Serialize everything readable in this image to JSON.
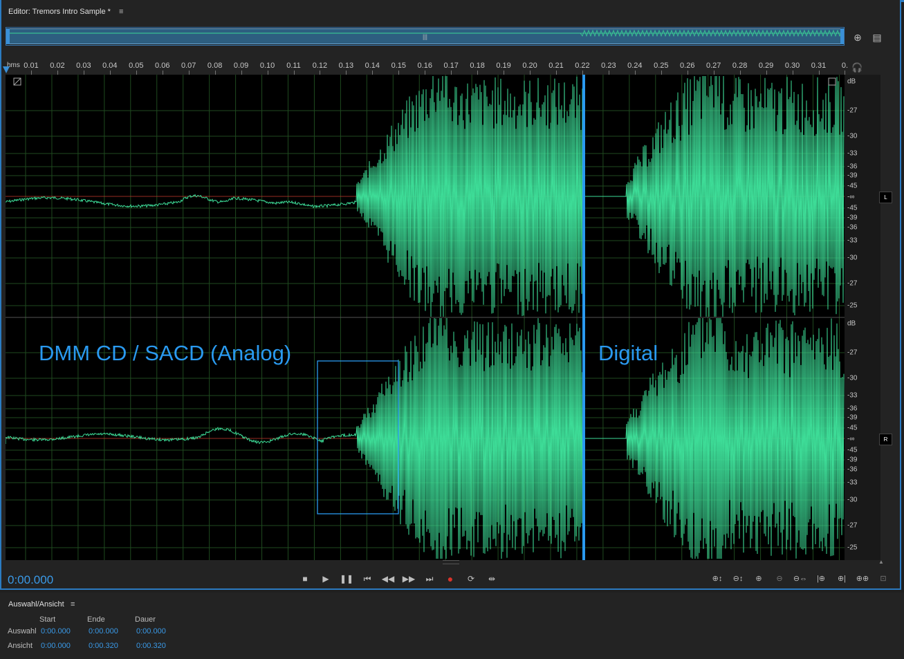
{
  "editor": {
    "title": "Editor: Tremors Intro Sample *",
    "menu_glyph": "≡"
  },
  "ruler": {
    "unit": "hms",
    "labels": [
      "0.01",
      "0.02",
      "0.03",
      "0.04",
      "0.05",
      "0.06",
      "0.07",
      "0.08",
      "0.09",
      "0.10",
      "0.11",
      "0.12",
      "0.13",
      "0.14",
      "0.15",
      "0.16",
      "0.17",
      "0.18",
      "0.19",
      "0.20",
      "0.21",
      "0.22",
      "0.23",
      "0.24",
      "0.25",
      "0.26",
      "0.27",
      "0.28",
      "0.29",
      "0.30",
      "0.31",
      "0."
    ]
  },
  "channels": {
    "L": {
      "label": "L",
      "db_scale": [
        "dB",
        "-27",
        "-30",
        "-33",
        "-36",
        "-39",
        "-45",
        "-∞",
        "-45",
        "-39",
        "-36",
        "-33",
        "-30",
        "-27",
        "-25"
      ]
    },
    "R": {
      "label": "R",
      "db_scale": [
        "dB",
        "-27",
        "-30",
        "-33",
        "-36",
        "-39",
        "-45",
        "-∞",
        "-45",
        "-39",
        "-36",
        "-33",
        "-30",
        "-27",
        "-25"
      ]
    }
  },
  "annotations": {
    "left": "DMM CD / SACD (Analog)",
    "right": "Digital"
  },
  "colors": {
    "waveform": "#3ddc97",
    "accent": "#2a9af0",
    "centerline": "#c0392b",
    "grid": "#1f4a1f"
  },
  "transport": {
    "current_time": "0:00.000",
    "buttons": [
      "stop",
      "play",
      "pause",
      "go-to-start",
      "rewind",
      "fast-forward",
      "go-to-end",
      "record",
      "loop",
      "skip-selection"
    ]
  },
  "zoom_tools": [
    "zoom-in-amplitude",
    "zoom-out-amplitude",
    "zoom-in-time",
    "zoom-out-time",
    "zoom-out-full",
    "zoom-in-at-start",
    "zoom-in-at-end",
    "zoom-to-selection",
    "zoom-reset"
  ],
  "selection_panel": {
    "title": "Auswahl/Ansicht",
    "menu_glyph": "≡",
    "columns": [
      "Start",
      "Ende",
      "Dauer"
    ],
    "rows": [
      {
        "label": "Auswahl",
        "start": "0:00.000",
        "end": "0:00.000",
        "duration": "0:00.000"
      },
      {
        "label": "Ansicht",
        "start": "0:00.000",
        "end": "0:00.320",
        "duration": "0:00.320"
      }
    ]
  },
  "overview": {
    "grip": "|||"
  }
}
